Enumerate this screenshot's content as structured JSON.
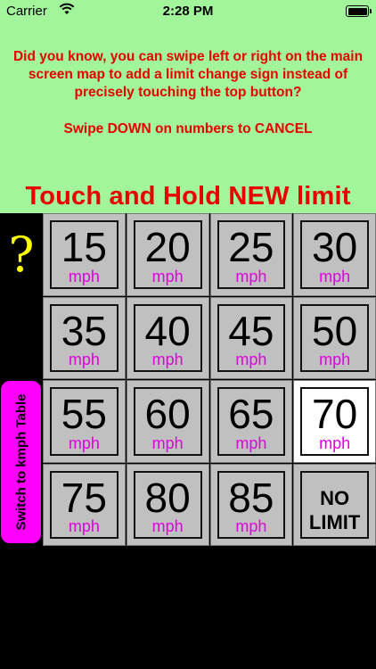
{
  "status_bar": {
    "carrier": "Carrier",
    "time": "2:28 PM",
    "wifi_icon": "wifi-icon",
    "battery_icon": "battery-icon"
  },
  "info": {
    "tip": "Did you know, you can swipe left or right on the main screen map to add a limit change sign instead of precisely touching the top button?",
    "cancel_hint": "Swipe DOWN on numbers to CANCEL",
    "headline": "Touch and Hold NEW limit"
  },
  "help": {
    "label": "?"
  },
  "unit_switch": {
    "label": "Switch to kmph Table"
  },
  "limits": [
    {
      "value": "15",
      "unit": "mph"
    },
    {
      "value": "20",
      "unit": "mph"
    },
    {
      "value": "25",
      "unit": "mph"
    },
    {
      "value": "30",
      "unit": "mph"
    },
    {
      "value": "35",
      "unit": "mph"
    },
    {
      "value": "40",
      "unit": "mph"
    },
    {
      "value": "45",
      "unit": "mph"
    },
    {
      "value": "50",
      "unit": "mph"
    },
    {
      "value": "55",
      "unit": "mph"
    },
    {
      "value": "60",
      "unit": "mph"
    },
    {
      "value": "65",
      "unit": "mph"
    },
    {
      "value": "70",
      "unit": "mph",
      "active": true
    },
    {
      "value": "75",
      "unit": "mph"
    },
    {
      "value": "80",
      "unit": "mph"
    },
    {
      "value": "85",
      "unit": "mph"
    }
  ],
  "no_limit": {
    "line1": "NO",
    "line2": "LIMIT"
  },
  "colors": {
    "panel_bg": "#a2f59b",
    "text_red": "#e80000",
    "help_yellow": "#ffff00",
    "switch_magenta": "#ff00ff",
    "unit_magenta": "#e000e0",
    "cell_gray": "#c0c0c0"
  }
}
